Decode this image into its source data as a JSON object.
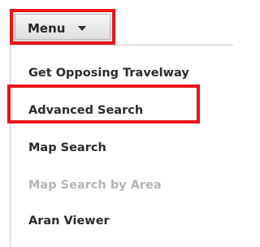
{
  "menu": {
    "label": "Menu",
    "icon": "chevron-down-icon",
    "items": [
      {
        "label": "Get Opposing Travelway",
        "enabled": true
      },
      {
        "label": "Advanced Search",
        "enabled": true,
        "highlighted": true
      },
      {
        "label": "Map Search",
        "enabled": true
      },
      {
        "label": "Map Search by Area",
        "enabled": false
      },
      {
        "label": "Aran Viewer",
        "enabled": true
      }
    ]
  },
  "colors": {
    "highlight_border": "#e8141c",
    "text": "#2b2b2b",
    "disabled_text": "#b4b4b4"
  }
}
